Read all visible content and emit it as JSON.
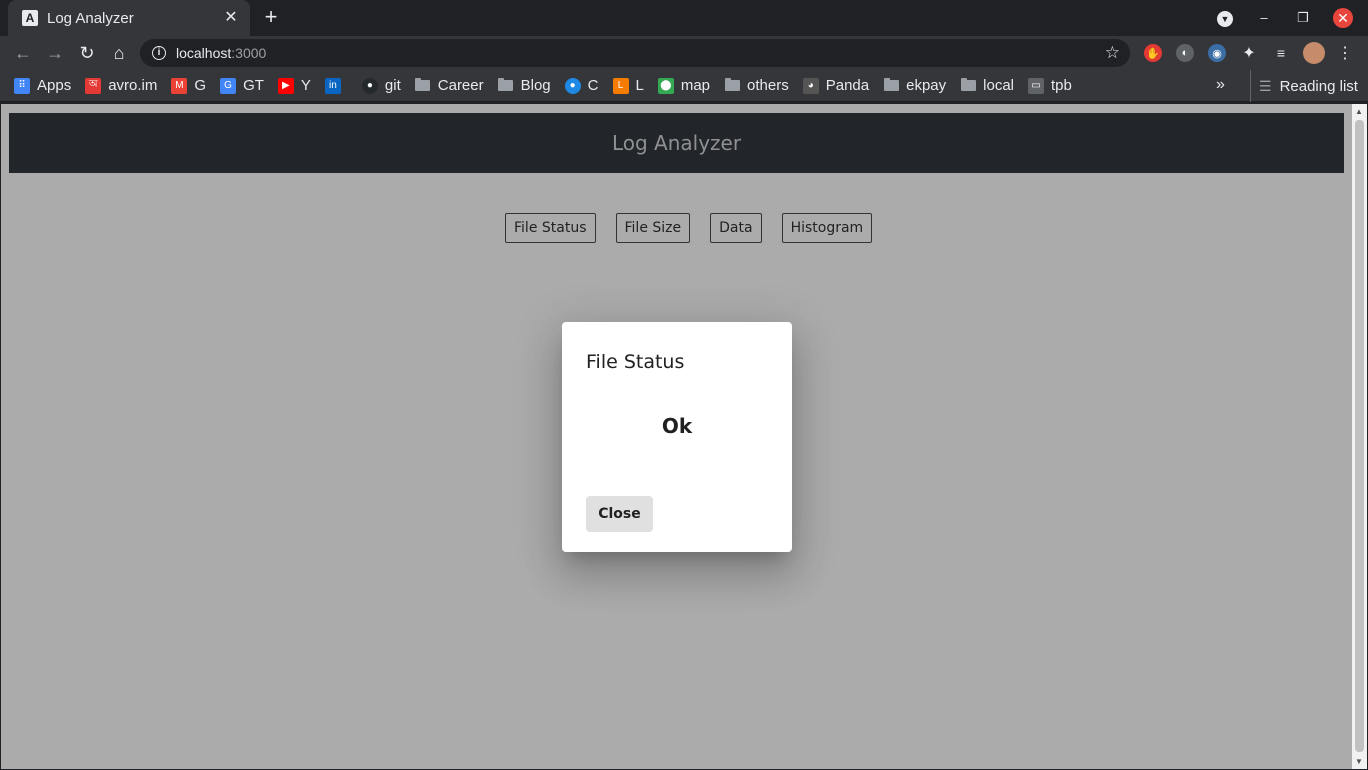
{
  "browser": {
    "tab_title": "Log Analyzer",
    "tab_favicon": "A",
    "url_host": "localhost",
    "url_port": ":3000",
    "bookmarks": [
      {
        "label": "Apps",
        "icon": "apps-grid-icon",
        "color": "#4285f4"
      },
      {
        "label": "avro.im",
        "icon": "avro-icon",
        "color": "#e53935"
      },
      {
        "label": "G",
        "icon": "gmail-icon",
        "color": "#ea4335"
      },
      {
        "label": "GT",
        "icon": "google-translate-icon",
        "color": "#4285f4"
      },
      {
        "label": "Y",
        "icon": "youtube-icon",
        "color": "#ff0000"
      },
      {
        "label": "",
        "icon": "linkedin-icon",
        "color": "#0a66c2"
      },
      {
        "label": "git",
        "icon": "github-icon",
        "color": "#24292e"
      },
      {
        "label": "Career",
        "icon": "folder-icon",
        "color": ""
      },
      {
        "label": "Blog",
        "icon": "folder-icon",
        "color": ""
      },
      {
        "label": "C",
        "icon": "c-site-icon",
        "color": "#1e88e5"
      },
      {
        "label": "L",
        "icon": "leetcode-icon",
        "color": "#f57c00"
      },
      {
        "label": "map",
        "icon": "google-maps-icon",
        "color": "#34a853"
      },
      {
        "label": "others",
        "icon": "folder-icon",
        "color": ""
      },
      {
        "label": "Panda",
        "icon": "panda-icon",
        "color": "#555555"
      },
      {
        "label": "ekpay",
        "icon": "folder-icon",
        "color": ""
      },
      {
        "label": "local",
        "icon": "folder-icon",
        "color": ""
      },
      {
        "label": "tpb",
        "icon": "tpb-icon",
        "color": "#5f6368"
      }
    ],
    "reading_list": "Reading list"
  },
  "app": {
    "header_title": "Log Analyzer",
    "nav_buttons": [
      "File Status",
      "File Size",
      "Data",
      "Histogram"
    ]
  },
  "dialog": {
    "title": "File Status",
    "content": "Ok",
    "close_label": "Close"
  },
  "colors": {
    "header_bg": "#222529",
    "backdrop": "#ababab",
    "dialog_bg": "#ffffff",
    "close_button_bg": "#e0e0e0"
  }
}
